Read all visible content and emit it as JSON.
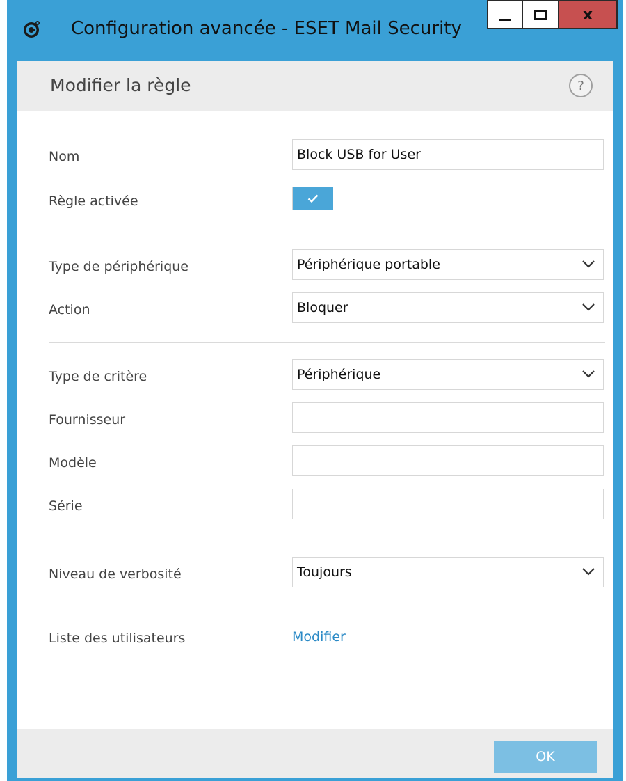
{
  "window": {
    "title": "Configuration avancée - ESET Mail Security",
    "minimize_icon": "minimize-icon",
    "maximize_icon": "maximize-icon",
    "close_label": "x",
    "accent_color": "#3aa0d6",
    "close_color": "#c75050"
  },
  "header": {
    "title": "Modifier la règle",
    "help_label": "?"
  },
  "form": {
    "name": {
      "label": "Nom",
      "value": "Block USB for User"
    },
    "rule_enabled": {
      "label": "Règle activée",
      "checked": true
    },
    "device_type": {
      "label": "Type de périphérique",
      "value": "Périphérique portable"
    },
    "action": {
      "label": "Action",
      "value": "Bloquer"
    },
    "criteria_type": {
      "label": "Type de critère",
      "value": "Périphérique"
    },
    "vendor": {
      "label": "Fournisseur",
      "value": ""
    },
    "model": {
      "label": "Modèle",
      "value": ""
    },
    "serial": {
      "label": "Série",
      "value": ""
    },
    "verbosity": {
      "label": "Niveau de verbosité",
      "value": "Toujours"
    },
    "user_list": {
      "label": "Liste des utilisateurs",
      "link": "Modifier"
    }
  },
  "footer": {
    "ok_label": "OK"
  }
}
